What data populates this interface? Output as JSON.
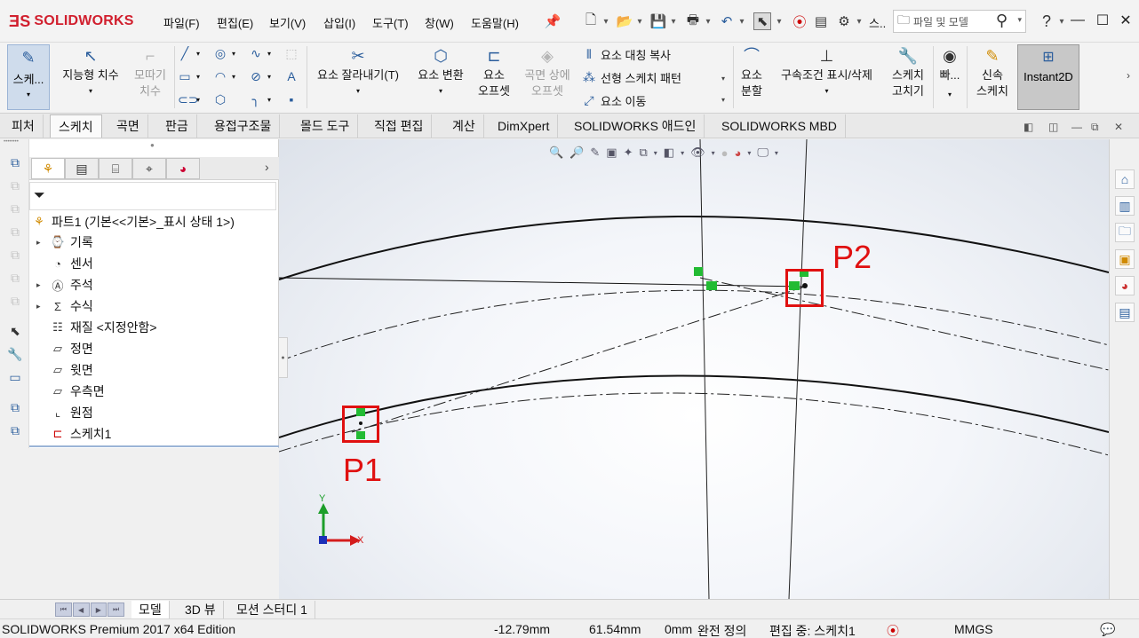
{
  "app": {
    "logo_text": "SOLIDWORKS",
    "brand_color": "#d11f2e"
  },
  "menu": {
    "items": [
      "파일(F)",
      "편집(E)",
      "보기(V)",
      "삽입(I)",
      "도구(T)",
      "창(W)",
      "도움말(H)"
    ],
    "search_placeholder": "파일 및 모델",
    "more_label": "스.."
  },
  "ribbon": {
    "sketch": "스케...",
    "smart_dimension": "지능형 치수",
    "trim_line1": "모따기",
    "trim_line2": "치수",
    "trim_entities": "요소 잘라내기(T)",
    "convert_entities": "요소 변환",
    "offset_line1": "요소",
    "offset_line2": "오프셋",
    "offset_surface_line1": "곡면 상에",
    "offset_surface_line2": "오프셋",
    "mirror": "요소 대칭 복사",
    "linear_pattern": "선형 스케치 패턴",
    "move": "요소 이동",
    "split_line1": "요소",
    "split_line2": "분할",
    "relations": "구속조건 표시/삭제",
    "repair_line1": "스케치",
    "repair_line2": "고치기",
    "quick_snaps": "빠...",
    "rapid_line1": "신속",
    "rapid_line2": "스케치",
    "instant2d": "Instant2D"
  },
  "tabs": [
    "피처",
    "스케치",
    "곡면",
    "판금",
    "용접구조물",
    "몰드 도구",
    "직접 편집",
    "계산",
    "DimXpert",
    "SOLIDWORKS 애드인",
    "SOLIDWORKS MBD"
  ],
  "active_tab": "스케치",
  "tree": {
    "root": "파트1  (기본<<기본>_표시 상태 1>)",
    "items": [
      {
        "label": "기록",
        "icon": "history-icon",
        "expandable": true
      },
      {
        "label": "센서",
        "icon": "sensor-icon",
        "expandable": false
      },
      {
        "label": "주석",
        "icon": "annotations-icon",
        "expandable": true
      },
      {
        "label": "수식",
        "icon": "equations-icon",
        "expandable": true
      },
      {
        "label": "재질 <지정안함>",
        "icon": "material-icon",
        "expandable": false
      },
      {
        "label": "정면",
        "icon": "plane-icon",
        "expandable": false
      },
      {
        "label": "윗면",
        "icon": "plane-icon",
        "expandable": false
      },
      {
        "label": "우측면",
        "icon": "plane-icon",
        "expandable": false
      },
      {
        "label": "원점",
        "icon": "origin-icon",
        "expandable": false
      },
      {
        "label": "스케치1",
        "icon": "sketch-icon",
        "expandable": false
      }
    ]
  },
  "viewport": {
    "p1_label": "P1",
    "p2_label": "P2",
    "axis_y": "Y",
    "axis_x": "X",
    "marker_color": "#e01010"
  },
  "bottom_tabs": [
    "모델",
    "3D 뷰",
    "모션 스터디 1"
  ],
  "status": {
    "edition": "SOLIDWORKS Premium 2017 x64 Edition",
    "x": "-12.79mm",
    "y": "61.54mm",
    "z": "0mm",
    "defined": "완전 정의",
    "editing": "편집 중: 스케치1",
    "units": "MMGS"
  }
}
